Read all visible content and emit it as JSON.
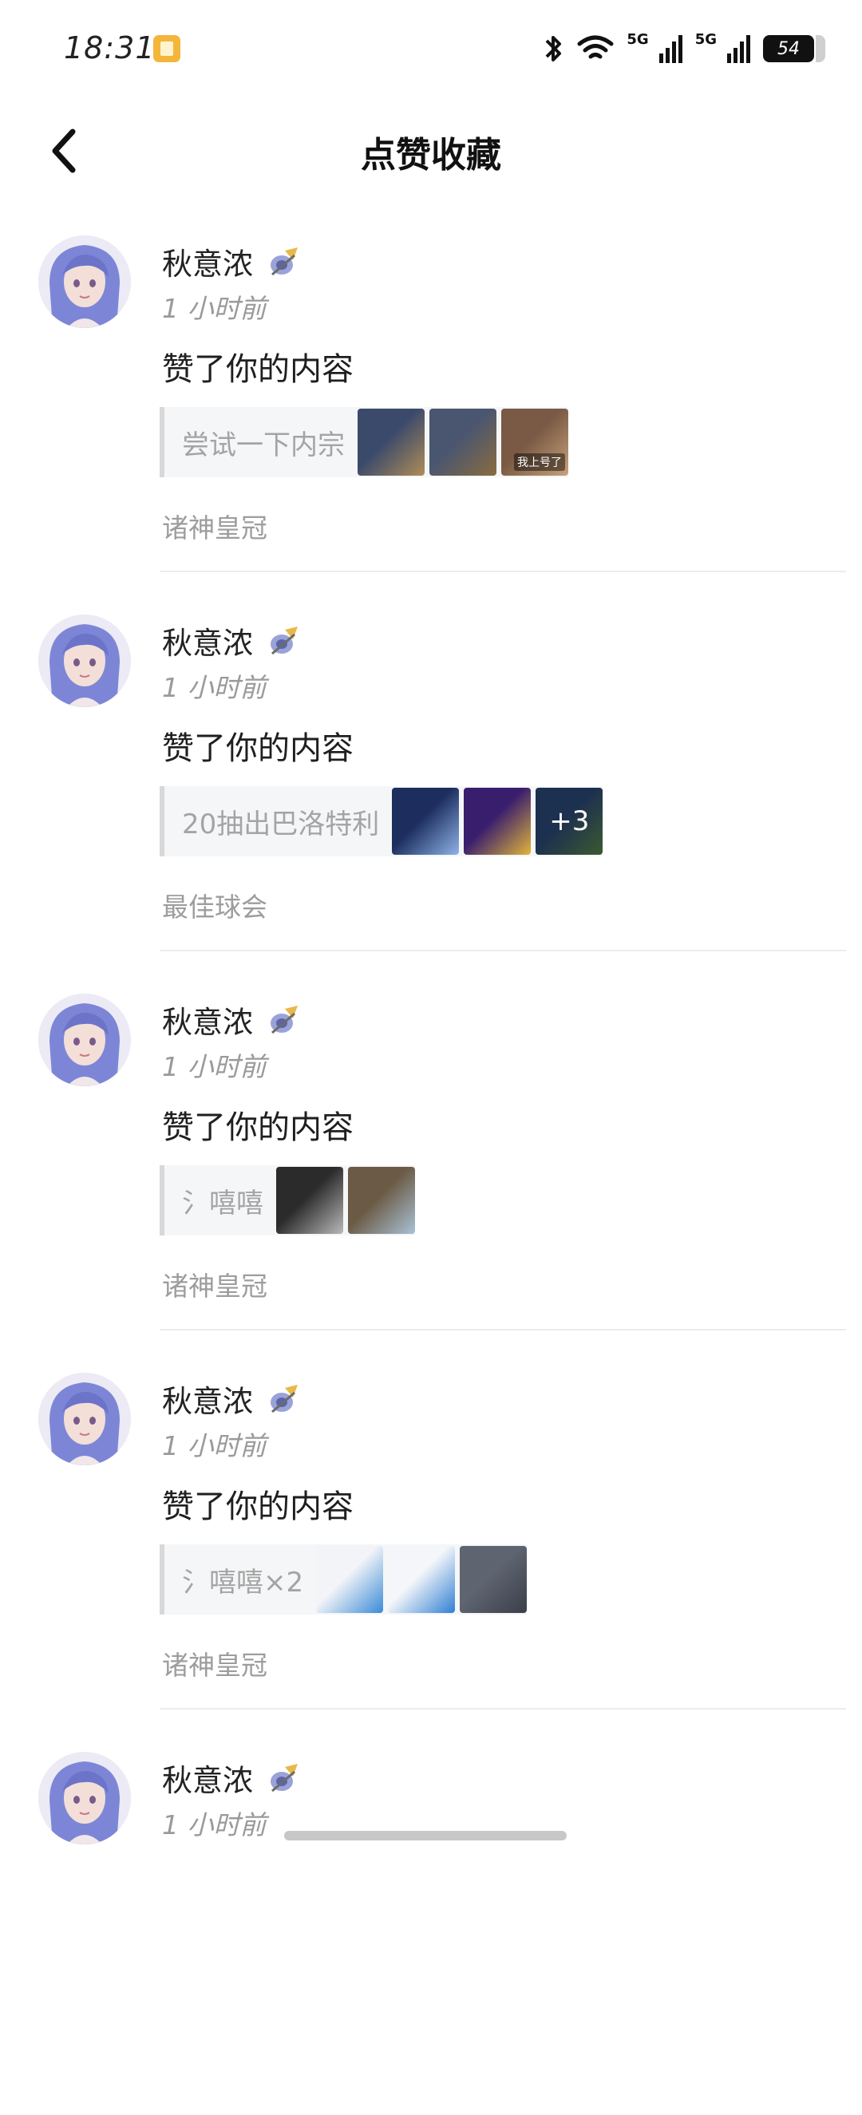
{
  "status_bar": {
    "time": "18:31",
    "network_1": "5G",
    "network_2": "5G",
    "battery": "54",
    "icons": [
      "notification-app-icon",
      "bluetooth-icon",
      "wifi-icon",
      "signal-icon",
      "signal-icon",
      "battery-icon"
    ]
  },
  "header": {
    "title": "点赞收藏",
    "back_icon": "chevron-left-icon"
  },
  "items": [
    {
      "user": "秋意浓",
      "time": "1 小时前",
      "action": "赞了你的内容",
      "quote": "尝试一下内宗",
      "thumbs": [
        {
          "colors": [
            "#3b4a6b",
            "#b08d57"
          ],
          "more": "",
          "caption": ""
        },
        {
          "colors": [
            "#4a5670",
            "#8a6c3f"
          ],
          "more": "",
          "caption": ""
        },
        {
          "colors": [
            "#7a5a45",
            "#c8a27a"
          ],
          "more": "",
          "caption": "我上号了"
        }
      ],
      "forum": "诸神皇冠"
    },
    {
      "user": "秋意浓",
      "time": "1 小时前",
      "action": "赞了你的内容",
      "quote": "20抽出巴洛特利",
      "thumbs": [
        {
          "colors": [
            "#1c2d5e",
            "#8fb3e8"
          ],
          "more": "",
          "caption": ""
        },
        {
          "colors": [
            "#3a1e6e",
            "#e0b53a"
          ],
          "more": "",
          "caption": ""
        },
        {
          "colors": [
            "#2c4a7a",
            "#5c8a4a"
          ],
          "more": "+3",
          "caption": ""
        }
      ],
      "forum": "最佳球会"
    },
    {
      "user": "秋意浓",
      "time": "1 小时前",
      "action": "赞了你的内容",
      "quote": "氵嘻嘻",
      "thumbs": [
        {
          "colors": [
            "#2b2b2b",
            "#b9b9b9"
          ],
          "more": "",
          "caption": ""
        },
        {
          "colors": [
            "#6b5a45",
            "#a9c2d6"
          ],
          "more": "",
          "caption": ""
        }
      ],
      "forum": "诸神皇冠"
    },
    {
      "user": "秋意浓",
      "time": "1 小时前",
      "action": "赞了你的内容",
      "quote": "氵嘻嘻×2",
      "thumbs": [
        {
          "colors": [
            "#f2f4f7",
            "#3a8ad8"
          ],
          "more": "",
          "caption": ""
        },
        {
          "colors": [
            "#f4f6f9",
            "#2f7fd3"
          ],
          "more": "",
          "caption": ""
        },
        {
          "colors": [
            "#5e6470",
            "#3a3f49"
          ],
          "more": "",
          "caption": ""
        }
      ],
      "forum": "诸神皇冠"
    },
    {
      "user": "秋意浓",
      "time": "1 小时前",
      "action": "",
      "quote": "",
      "thumbs": [],
      "forum": ""
    }
  ]
}
